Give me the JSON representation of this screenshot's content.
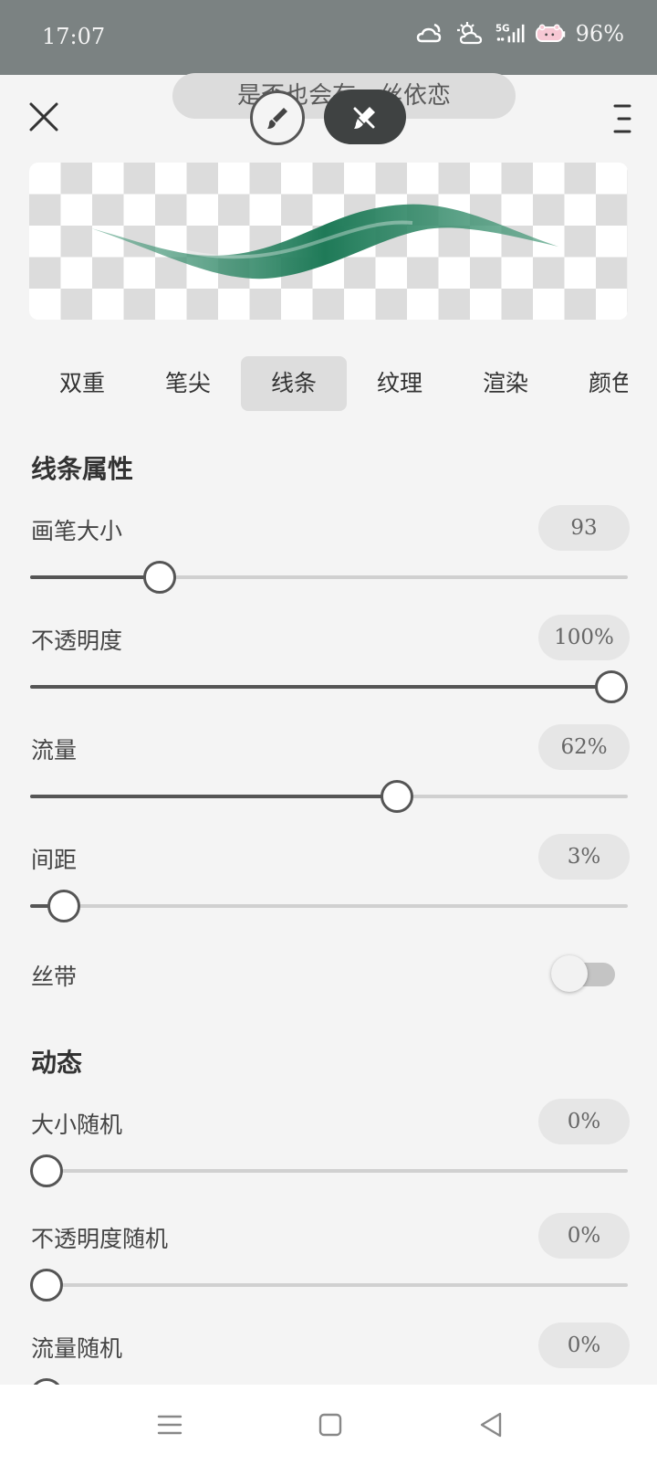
{
  "status_bar": {
    "time": "17:07",
    "battery_percent": "96%",
    "network_label": "5G",
    "icons": [
      "cloudy-night-icon",
      "cloudy-sun-icon",
      "signal-5g-icon",
      "battery-icon"
    ]
  },
  "header": {
    "lyric_text": "是否也会有一丝依恋",
    "close_icon": "close-icon",
    "menu_icon": "menu-icon",
    "brush_mode_icon": "brush-icon",
    "eraser_mode_icon": "eraser-icon"
  },
  "preview": {
    "stroke_color": "#2e8b6a"
  },
  "tabs": [
    {
      "label": "双重",
      "active": false
    },
    {
      "label": "笔尖",
      "active": false
    },
    {
      "label": "线条",
      "active": true
    },
    {
      "label": "纹理",
      "active": false
    },
    {
      "label": "渲染",
      "active": false
    },
    {
      "label": "颜色",
      "active": false
    }
  ],
  "line_properties": {
    "title": "线条属性",
    "brush_size": {
      "label": "画笔大小",
      "value": "93",
      "level": 0.2
    },
    "opacity": {
      "label": "不透明度",
      "value": "100%",
      "level": 1.0
    },
    "flow": {
      "label": "流量",
      "value": "62%",
      "level": 0.62
    },
    "spacing": {
      "label": "间距",
      "value": "3%",
      "level": 0.03
    },
    "ribbon": {
      "label": "丝带",
      "on": false
    }
  },
  "dynamics": {
    "title": "动态",
    "size_random": {
      "label": "大小随机",
      "value": "0%",
      "level": 0
    },
    "opacity_random": {
      "label": "不透明度随机",
      "value": "0%",
      "level": 0
    },
    "flow_random": {
      "label": "流量随机",
      "value": "0%",
      "level": 0
    }
  },
  "colors": {
    "accent_dark": "#3f4242",
    "status_bar_bg": "#7b8282"
  }
}
